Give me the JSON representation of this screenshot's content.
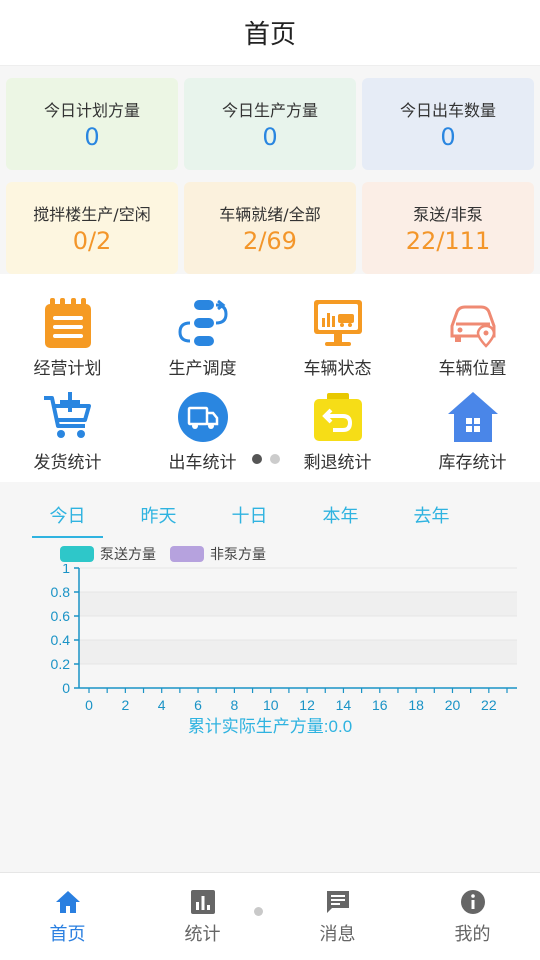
{
  "header": {
    "title": "首页"
  },
  "stats": [
    {
      "label": "今日计划方量",
      "value": "0",
      "bg": "#ecf6e4",
      "color": "#2a86e0"
    },
    {
      "label": "今日生产方量",
      "value": "0",
      "bg": "#e8f4ec",
      "color": "#2a86e0"
    },
    {
      "label": "今日出车数量",
      "value": "0",
      "bg": "#e6ecf6",
      "color": "#2a86e0"
    },
    {
      "label": "搅拌楼生产/空闲",
      "value": "0/2",
      "bg": "#fdf6e0",
      "color": "#f3962a"
    },
    {
      "label": "车辆就绪/全部",
      "value": "2/69",
      "bg": "#fbf1dd",
      "color": "#f3962a"
    },
    {
      "label": "泵送/非泵",
      "value": "22/111",
      "bg": "#fbeee6",
      "color": "#f3962a"
    }
  ],
  "menu": [
    {
      "label": "经营计划",
      "icon": "calendar-list-icon"
    },
    {
      "label": "生产调度",
      "icon": "dispatch-flow-icon"
    },
    {
      "label": "车辆状态",
      "icon": "monitor-truck-icon"
    },
    {
      "label": "车辆位置",
      "icon": "car-location-icon"
    },
    {
      "label": "发货统计",
      "icon": "cart-add-icon"
    },
    {
      "label": "出车统计",
      "icon": "truck-circle-icon"
    },
    {
      "label": "剩退统计",
      "icon": "return-box-icon"
    },
    {
      "label": "库存统计",
      "icon": "warehouse-icon"
    }
  ],
  "tabs": [
    "今日",
    "昨天",
    "十日",
    "本年",
    "去年"
  ],
  "legend": [
    {
      "name": "泵送方量",
      "color": "#2ec7c9"
    },
    {
      "name": "非泵方量",
      "color": "#b6a2de"
    }
  ],
  "chart_data": {
    "type": "bar",
    "x": [
      0,
      2,
      4,
      6,
      8,
      10,
      12,
      14,
      16,
      18,
      20,
      22
    ],
    "y_ticks": [
      "0",
      "0.2",
      "0.4",
      "0.6",
      "0.8",
      "1"
    ],
    "ylim": [
      0,
      1
    ],
    "series": [
      {
        "name": "泵送方量",
        "values": [
          0,
          0,
          0,
          0,
          0,
          0,
          0,
          0,
          0,
          0,
          0,
          0,
          0,
          0,
          0,
          0,
          0,
          0,
          0,
          0,
          0,
          0,
          0,
          0
        ]
      },
      {
        "name": "非泵方量",
        "values": [
          0,
          0,
          0,
          0,
          0,
          0,
          0,
          0,
          0,
          0,
          0,
          0,
          0,
          0,
          0,
          0,
          0,
          0,
          0,
          0,
          0,
          0,
          0,
          0
        ]
      }
    ],
    "summary": "累计实际生产方量:0.0",
    "axis_color": "#1a93c6"
  },
  "nav": [
    {
      "label": "首页",
      "icon": "home-icon"
    },
    {
      "label": "统计",
      "icon": "bar-chart-icon"
    },
    {
      "label": "消息",
      "icon": "message-icon"
    },
    {
      "label": "我的",
      "icon": "info-icon"
    }
  ]
}
